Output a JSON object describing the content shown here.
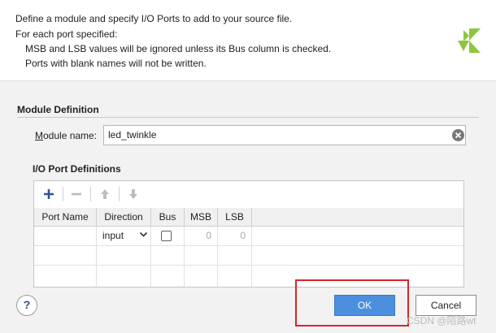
{
  "header": {
    "line1": "Define a module and specify I/O Ports to add to your source file.",
    "line2": "For each port specified:",
    "line3": "MSB and LSB values will be ignored unless its Bus column is checked.",
    "line4": "Ports with blank names will not be written."
  },
  "module_definition": {
    "title": "Module Definition",
    "name_label": "Module name:",
    "name_value": "led_twinkle"
  },
  "io_ports": {
    "title": "I/O Port Definitions",
    "toolbar": [
      "add-icon",
      "remove-icon",
      "move-up-icon",
      "move-down-icon"
    ],
    "columns": [
      "Port Name",
      "Direction",
      "Bus",
      "MSB",
      "LSB"
    ],
    "rows": [
      {
        "port_name": "",
        "direction": "input",
        "bus": false,
        "msb": "0",
        "lsb": "0"
      }
    ]
  },
  "buttons": {
    "help": "?",
    "ok": "OK",
    "cancel": "Cancel"
  },
  "watermark": "CSDN @陌路wt",
  "colors": {
    "accent": "#4b8fde",
    "highlight": "#d9232b",
    "logo": "#8dc63f"
  }
}
